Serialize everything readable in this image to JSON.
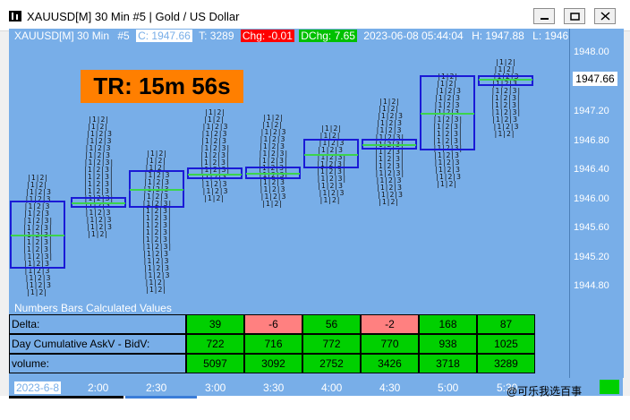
{
  "window": {
    "title": "XAUUSD[M]  30 Min  #5 | Gold / US Dollar"
  },
  "info_line": {
    "symbol": "XAUUSD[M]  30 Min",
    "number": "#5",
    "close": "C: 1947.66",
    "time": "T: 3289",
    "chg": "Chg: -0.01",
    "dchg": "DChg: 7.65",
    "datetime": "2023-06-08 05:44:04",
    "high": "H: 1947.88",
    "low": "L: 1946."
  },
  "price_axis": {
    "ticks": [
      "1948.00",
      "1947.20",
      "1946.80",
      "1946.40",
      "1946.00",
      "1945.60",
      "1945.20",
      "1944.80"
    ],
    "current_price": "1947.66"
  },
  "timer": {
    "label": "TR: 15m 56s"
  },
  "plot_title": "Numbers Bars Calculated Values",
  "grid": {
    "rows": [
      {
        "label": "Delta:",
        "values": [
          "39",
          "-6",
          "56",
          "-2",
          "168",
          "87"
        ]
      },
      {
        "label": "Day Cumulative AskV - BidV:",
        "values": [
          "722",
          "716",
          "772",
          "770",
          "938",
          "1025"
        ]
      },
      {
        "label": "volume:",
        "values": [
          "5097",
          "3092",
          "2752",
          "3426",
          "3718",
          "3289"
        ]
      }
    ],
    "colors": {
      "positive": "#00d000",
      "negative": "#ff8080"
    }
  },
  "time_axis": {
    "labels": [
      "2023-6-8",
      "2:00",
      "2:30",
      "3:00",
      "3:30",
      "4:00",
      "4:30",
      "5:00",
      "5:30"
    ]
  },
  "watermark": "@可乐我选百事",
  "colors": {
    "background": "#78aee8",
    "value_area_box": "#1a1ad6",
    "poc": "#3bd44b",
    "timer_box": "#ff7f00"
  }
}
